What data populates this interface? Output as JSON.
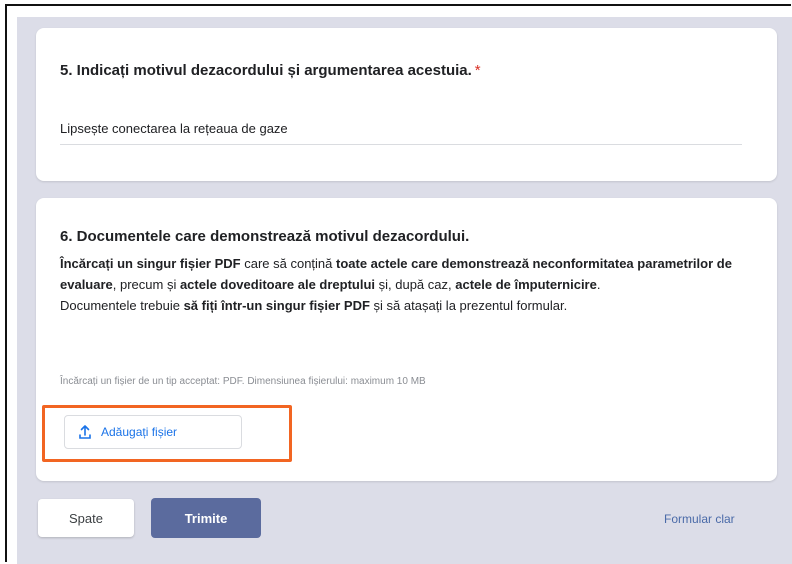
{
  "question5": {
    "title": "5. Indicați motivul dezacordului și argumentarea acestuia.",
    "required_mark": "*",
    "answer": "Lipsește conectarea la rețeaua de gaze"
  },
  "question6": {
    "title": "6. Documentele care demonstrează motivul dezacordului.",
    "desc": {
      "p1": "Încărcați un singur fișier PDF",
      "p2": " care să conțină ",
      "p3": "toate actele care demonstrează neconformitatea parametrilor de evaluare",
      "p4": ", precum și ",
      "p5": "actele doveditoare ale dreptului",
      "p6": " și, după caz, ",
      "p7": "actele de împuternicire",
      "p8": ".",
      "p9": "Documentele trebuie ",
      "p10": "să fiți într-un singur fișier PDF",
      "p11": " și să atașați la prezentul formular."
    },
    "hint": "Încărcați un fișier de un tip acceptat: PDF. Dimensiunea fișierului: maximum 10 MB",
    "upload_label": "Adăugați fișier",
    "upload_icon": "upload-icon"
  },
  "footer": {
    "back_label": "Spate",
    "submit_label": "Trimite",
    "clear_label": "Formular clar"
  },
  "colors": {
    "background": "#dcdde8",
    "submit": "#5b6b9e",
    "accent": "#1a73e8",
    "required": "#d93025",
    "highlight": "#f26522"
  }
}
